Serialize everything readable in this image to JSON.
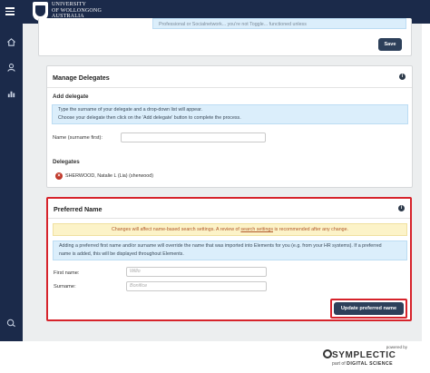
{
  "header": {
    "university_line1": "UNIVERSITY",
    "university_line2": "OF WOLLONGONG",
    "university_line3": "AUSTRALIA"
  },
  "sidebar": {
    "icons": [
      "menu-icon",
      "home-icon",
      "user-icon",
      "chart-icon",
      "logout-icon"
    ]
  },
  "top_card": {
    "infobox_text": "Professional or Socialnetwork... you're not Toggle... functioned unless",
    "save_label": "Save"
  },
  "delegates_card": {
    "title": "Manage Delegates",
    "add_delegate_heading": "Add delegate",
    "info_line1": "Type the surname of your delegate and a drop-down list will appear.",
    "info_line2": "Choose your delegate then click on the 'Add delegate' button to complete the process.",
    "name_label": "Name (surname first):",
    "name_value": "",
    "delegates_heading": "Delegates",
    "delegate_name": "SHERWOOD, Natalie L (Lia) (sherwood)"
  },
  "preferred_card": {
    "title": "Preferred Name",
    "warning_prefix": "Changes will affect name-based search settings. A review of ",
    "warning_link": "search settings",
    "warning_suffix": " is recommended after any change.",
    "info_line1": "Adding a preferred first name and/or surname will override the name that was imported into Elements for you (e.g. from your HR systems). If a preferred",
    "info_line2": "name is added, this will be displayed throughout Elements.",
    "first_name_label": "First name:",
    "first_name_placeholder": "Willo",
    "surname_label": "Surname:",
    "surname_placeholder": "Bonifice",
    "update_button_label": "Update preferred name"
  },
  "footer": {
    "powered_by": "powered by",
    "brand": "SYMPLECTIC",
    "part_of": "part of",
    "parent_brand": "DIGITAL SCIENCE"
  },
  "colors": {
    "navy": "#1b2a4a",
    "button": "#2d405a",
    "highlight_red": "#d6232b",
    "info_blue": "#dbeefb",
    "warning_yellow": "#fcf3c8"
  }
}
